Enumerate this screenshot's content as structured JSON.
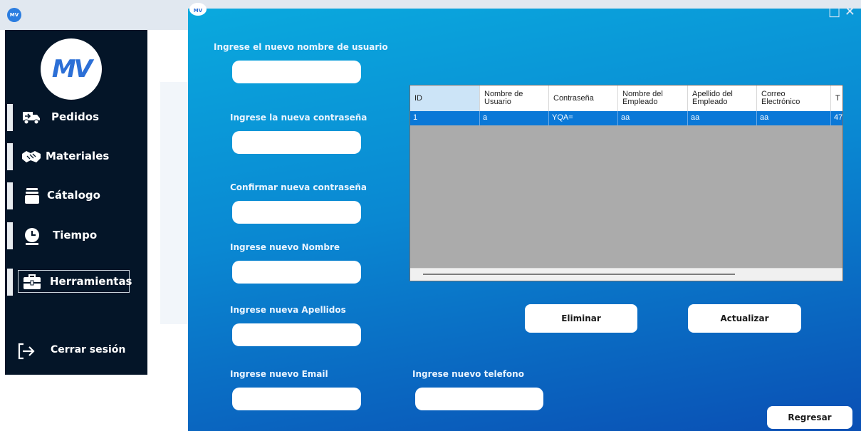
{
  "outer": {
    "logo_text": "MV",
    "sidebar": {
      "logo_text": "MV",
      "items": [
        {
          "label": "Pedidos",
          "icon": "truck-icon"
        },
        {
          "label": "Materiales",
          "icon": "handshake-icon"
        },
        {
          "label": "Cátalogo",
          "icon": "layers-icon"
        },
        {
          "label": "Tiempo",
          "icon": "clock-icon"
        },
        {
          "label": "Herramientas",
          "icon": "toolbox-icon"
        }
      ],
      "logout_label": "Cerrar sesión"
    }
  },
  "inner": {
    "logo_text": "MV",
    "fields": {
      "username_label": "Ingrese el nuevo nombre de usuario",
      "password_label": "Ingrese la nueva contraseña",
      "confirm_label": "Confirmar nueva contraseña",
      "name_label": "Ingrese nuevo Nombre",
      "lastname_label": "Ingrese nueva Apellidos",
      "email_label": "Ingrese nuevo Email",
      "phone_label": "Ingrese nuevo telefono"
    },
    "grid": {
      "columns": [
        "ID",
        "Nombre de Usuario",
        "Contraseña",
        "Nombre del Empleado",
        "Apellido del Empleado",
        "Correo Electrónico",
        "T"
      ],
      "rows": [
        [
          "1",
          "a",
          "YQA=",
          "aa",
          "aa",
          "aa",
          "47"
        ]
      ]
    },
    "buttons": {
      "delete": "Eliminar",
      "update": "Actualizar",
      "back": "Regresar"
    }
  }
}
